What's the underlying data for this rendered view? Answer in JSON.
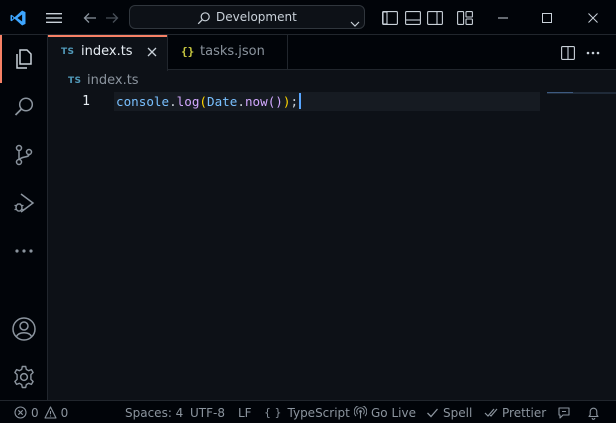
{
  "titlebar": {
    "search_label": "Development"
  },
  "tabs": [
    {
      "icon_label": "TS",
      "label": "index.ts",
      "active": true
    },
    {
      "icon_label": "{}",
      "label": "tasks.json",
      "active": false
    }
  ],
  "breadcrumb": {
    "icon_label": "TS",
    "file": "index.ts"
  },
  "editor": {
    "line_number": "1",
    "code": {
      "t1": "console",
      "t2": ".",
      "t3": "log",
      "t4": "(",
      "t5": "Date",
      "t6": ".",
      "t7": "now",
      "t8": "()",
      "t9": ")",
      "t10": ";"
    }
  },
  "statusbar": {
    "errors": "0",
    "warnings": "0",
    "spaces": "Spaces: 4",
    "encoding": "UTF-8",
    "eol": "LF",
    "language_icon": "{ }",
    "language": "TypeScript",
    "go_live": "Go Live",
    "spell": "Spell",
    "prettier": "Prettier"
  },
  "colors": {
    "accent": "#f78166",
    "background": "#0d1117",
    "chrome": "#010409",
    "vscode_blue": "#3ea6ff"
  }
}
